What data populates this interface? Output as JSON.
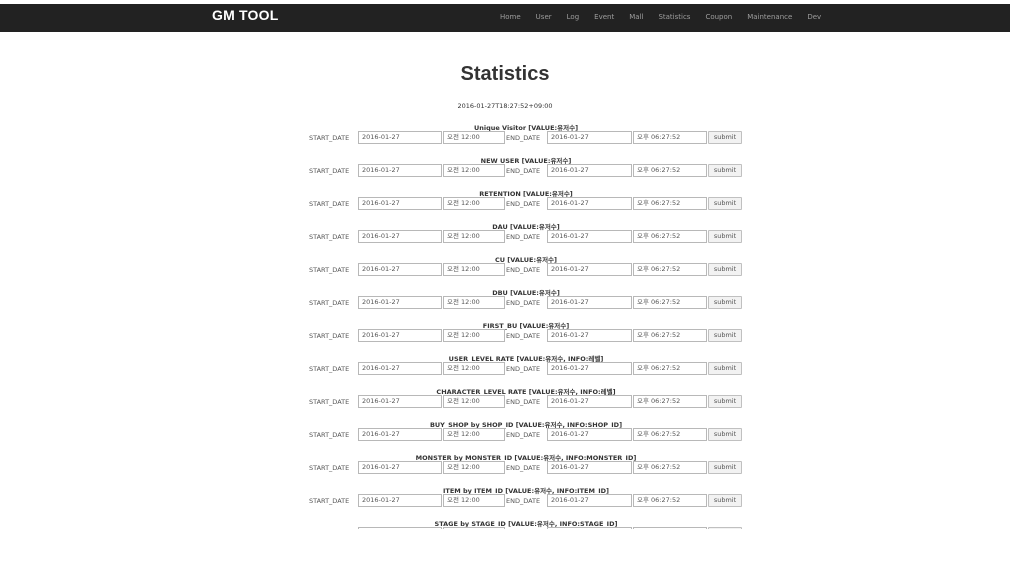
{
  "navbar": {
    "brand": "GM TOOL",
    "items": [
      "Home",
      "User",
      "Log",
      "Event",
      "Mall",
      "Statistics",
      "Coupon",
      "Maintenance",
      "Dev"
    ]
  },
  "page": {
    "title": "Statistics",
    "timestamp": "2016-01-27T18:27:52+09:00"
  },
  "form_labels": {
    "start_date": "START_DATE",
    "end_date": "END_DATE",
    "submit": "submit"
  },
  "defaults": {
    "start_date": "2016-01-27",
    "start_time": "오전 12:00",
    "end_date": "2016-01-27",
    "end_time": "오후 06:27:52"
  },
  "stats": [
    {
      "heading": "Unique Visitor [VALUE:유저수]"
    },
    {
      "heading": "NEW USER [VALUE:유저수]"
    },
    {
      "heading": "RETENTION [VALUE:유저수]"
    },
    {
      "heading": "DAU [VALUE:유저수]"
    },
    {
      "heading": "CU [VALUE:유저수]"
    },
    {
      "heading": "DBU [VALUE:유저수]"
    },
    {
      "heading": "FIRST_BU [VALUE:유저수]"
    },
    {
      "heading": "USER_LEVEL RATE [VALUE:유저수, INFO:레벨]"
    },
    {
      "heading": "CHARACTER_LEVEL RATE [VALUE:유저수, INFO:레벨]"
    },
    {
      "heading": "BUY_SHOP by SHOP_ID [VALUE:유저수, INFO:SHOP_ID]"
    },
    {
      "heading": "MONSTER by MONSTER_ID [VALUE:유저수, INFO:MONSTER_ID]"
    },
    {
      "heading": "ITEM by ITEM_ID [VALUE:유저수, INFO:ITEM_ID]"
    },
    {
      "heading": "STAGE by STAGE_ID [VALUE:유저수, INFO:STAGE_ID]"
    }
  ]
}
